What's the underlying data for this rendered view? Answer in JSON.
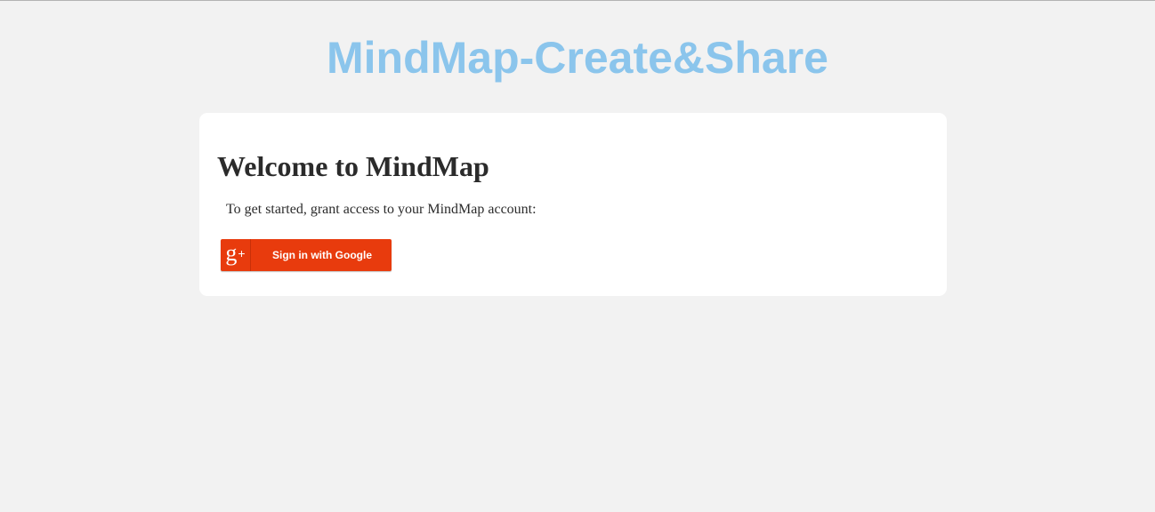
{
  "site": {
    "title": "MindMap-Create&Share"
  },
  "card": {
    "heading": "Welcome to MindMap",
    "instruction": "To get started, grant access to your MindMap account:",
    "google_button": {
      "icon_glyph": "g",
      "icon_plus": "+",
      "label": "Sign in with Google"
    }
  },
  "colors": {
    "title": "#8bc5ec",
    "background": "#f2f2f2",
    "card": "#ffffff",
    "google_button": "#e83b0d"
  },
  "icons": {
    "google_plus": "google-plus-icon"
  }
}
